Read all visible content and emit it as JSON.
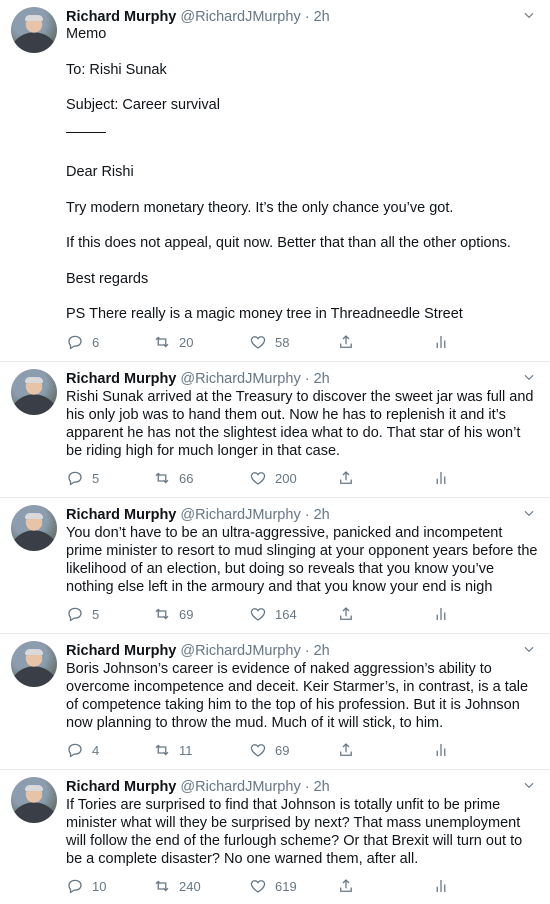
{
  "tweets": [
    {
      "name": "Richard Murphy",
      "handle": "@RichardJMurphy",
      "time": "· 2h",
      "paragraphs": [
        "Memo",
        "To: Rishi Sunak",
        "Subject: Career survival",
        "Dear Rishi",
        "Try modern monetary theory. It’s the only chance you’ve got.",
        "If this does not appeal, quit now. Better that than all the other options.",
        "Best regards",
        "PS There really is a magic money tree in Threadneedle Street"
      ],
      "replies": "6",
      "retweets": "20",
      "likes": "58"
    },
    {
      "name": "Richard Murphy",
      "handle": "@RichardJMurphy",
      "time": "· 2h",
      "text": "Rishi Sunak arrived at the Treasury to discover the sweet jar was full and his only job was to hand them out. Now he has to replenish it and it’s apparent he has not the slightest idea what to do. That star of his won’t be riding high for much longer in that case.",
      "replies": "5",
      "retweets": "66",
      "likes": "200"
    },
    {
      "name": "Richard Murphy",
      "handle": "@RichardJMurphy",
      "time": "· 2h",
      "text": "You don’t have to be an ultra-aggressive, panicked and incompetent prime minister to resort to mud slinging at your opponent years before the likelihood of an election, but doing so reveals that you know you’ve nothing else left in the armoury and that you know your end is nigh",
      "replies": "5",
      "retweets": "69",
      "likes": "164"
    },
    {
      "name": "Richard Murphy",
      "handle": "@RichardJMurphy",
      "time": "· 2h",
      "text": "Boris Johnson’s career is evidence of naked aggression’s ability to overcome incompetence and deceit. Keir Starmer’s, in contrast, is a tale of competence taking him to the top of his profession. But it is Johnson now planning to throw the mud. Much of it will stick, to him.",
      "replies": "4",
      "retweets": "11",
      "likes": "69"
    },
    {
      "name": "Richard Murphy",
      "handle": "@RichardJMurphy",
      "time": "· 2h",
      "text": "If Tories are surprised to find that Johnson is totally unfit to be prime minister what will they be surprised by next? That mass unemployment will follow the end of the furlough scheme? Or that Brexit will turn out to be a complete  disaster? No one warned them, after all.",
      "replies": "10",
      "retweets": "240",
      "likes": "619"
    }
  ]
}
